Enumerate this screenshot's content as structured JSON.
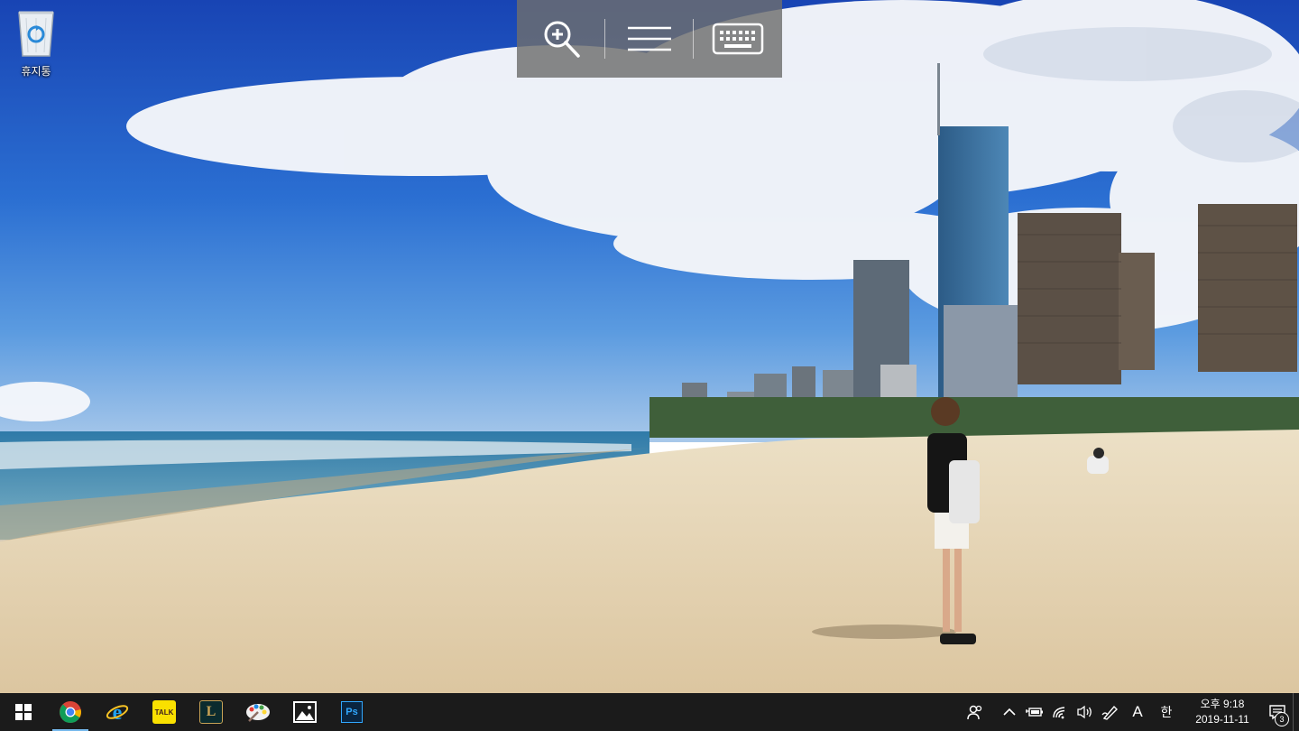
{
  "desktop": {
    "recycle_bin": {
      "label": "휴지통",
      "icon": "recycle-bin-icon"
    }
  },
  "remote_toolbar": {
    "buttons": [
      {
        "icon": "zoom-in-icon"
      },
      {
        "icon": "menu-icon"
      },
      {
        "icon": "keyboard-icon"
      }
    ]
  },
  "taskbar": {
    "start_icon": "windows-start-icon",
    "apps": [
      {
        "icon": "chrome-icon",
        "active": true
      },
      {
        "icon": "internet-explorer-icon"
      },
      {
        "icon": "kakaotalk-icon",
        "text": "TALK"
      },
      {
        "icon": "league-of-legends-icon",
        "text": "L"
      },
      {
        "icon": "paint-app-icon"
      },
      {
        "icon": "photos-icon"
      },
      {
        "icon": "photoshop-icon",
        "text": "Ps"
      }
    ],
    "tray": {
      "ime_mode": "A",
      "ime_lang": "한",
      "time": "오후 9:18",
      "date": "2019-11-11",
      "notification_count": "3"
    }
  },
  "colors": {
    "taskbar_bg": "#1b1b1b",
    "sky_top": "#1f4fb8",
    "sand": "#e6d5b4",
    "accent": "#76b9ed"
  }
}
